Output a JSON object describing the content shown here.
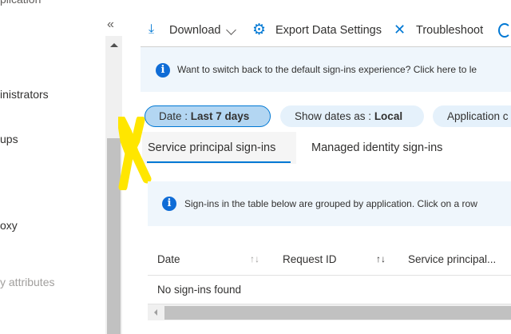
{
  "sidebar": {
    "items": [
      "plication",
      "inistrators",
      "ups",
      "oxy",
      "y attributes"
    ],
    "collapse_label": "«"
  },
  "toolbar": {
    "download": "Download",
    "export": "Export Data Settings",
    "troubleshoot": "Troubleshoot"
  },
  "banner_top": {
    "text": "Want to switch back to the default sign-ins experience? Click here to le"
  },
  "filters": {
    "date_label": "Date : ",
    "date_value": "Last 7 days",
    "show_label": "Show dates as : ",
    "show_value": "Local",
    "application_label": "Application c"
  },
  "tabs": [
    {
      "label": "Service principal sign-ins",
      "active": true
    },
    {
      "label": "Managed identity sign-ins",
      "active": false
    }
  ],
  "banner_group": {
    "text": "Sign-ins in the table below are grouped by application. Click on a row"
  },
  "table": {
    "columns": [
      "Date",
      "Request ID",
      "Service principal..."
    ],
    "sort_glyph": "↑↓",
    "empty": "No sign-ins found"
  },
  "colors": {
    "accent": "#0078d4",
    "annotation": "#ffe600"
  }
}
